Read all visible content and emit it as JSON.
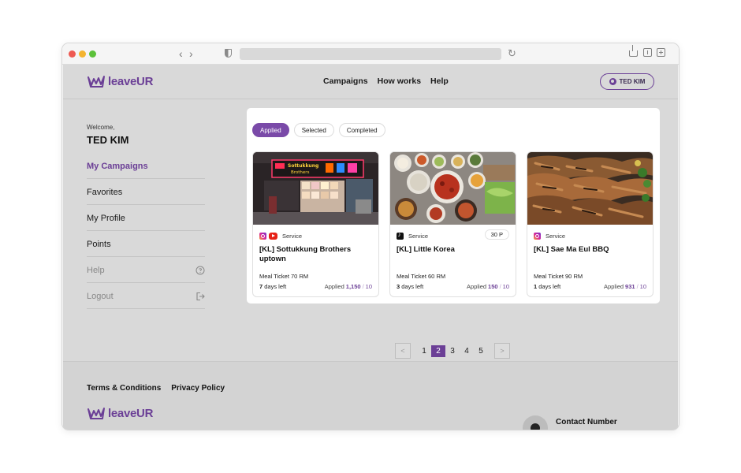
{
  "brand": {
    "name": "leaveUR",
    "color": "#6b3f96"
  },
  "nav": {
    "items": [
      "Campaigns",
      "How works",
      "Help"
    ]
  },
  "user": {
    "name": "TED KIM"
  },
  "sidebar": {
    "welcome": "Welcome,",
    "username": "TED KIM",
    "items": [
      {
        "label": "My Campaigns"
      },
      {
        "label": "Favorites"
      },
      {
        "label": "My Profile"
      },
      {
        "label": "Points"
      },
      {
        "label": "Help",
        "icon": "question-circle-icon"
      },
      {
        "label": "Logout",
        "icon": "logout-icon"
      }
    ]
  },
  "tabs": [
    {
      "label": "Applied",
      "selected": true
    },
    {
      "label": "Selected",
      "selected": false
    },
    {
      "label": "Completed",
      "selected": false
    }
  ],
  "campaigns": [
    {
      "platforms": [
        "instagram-icon",
        "youtube-icon"
      ],
      "type": "Service",
      "points": "",
      "title": "[KL] Sottukkung Brothers uptown",
      "ticket": "Meal Ticket 70 RM",
      "days_num": "7",
      "days_text": " days left",
      "applied_label": "Applied",
      "applied_count": "1,150",
      "sep": "/",
      "capacity": "10"
    },
    {
      "platforms": [
        "tiktok-icon"
      ],
      "type": "Service",
      "points": "30 P",
      "title": "[KL] Little Korea",
      "ticket": "Meal Ticket 60 RM",
      "days_num": "3",
      "days_text": " days left",
      "applied_label": "Applied",
      "applied_count": "150",
      "sep": "/",
      "capacity": "10"
    },
    {
      "platforms": [
        "instagram-icon"
      ],
      "type": "Service",
      "points": "",
      "title": "[KL] Sae Ma Eul BBQ",
      "ticket": "Meal Ticket 90 RM",
      "days_num": "1",
      "days_text": " days left",
      "applied_label": "Applied",
      "applied_count": "931",
      "sep": "/",
      "capacity": "10"
    }
  ],
  "pagination": {
    "pages": [
      "1",
      "2",
      "3",
      "4",
      "5"
    ],
    "current": "2",
    "prev": "<",
    "next": ">"
  },
  "footer": {
    "links": [
      "Terms & Conditions",
      "Privacy Policy"
    ],
    "contact_label": "Contact Number"
  }
}
